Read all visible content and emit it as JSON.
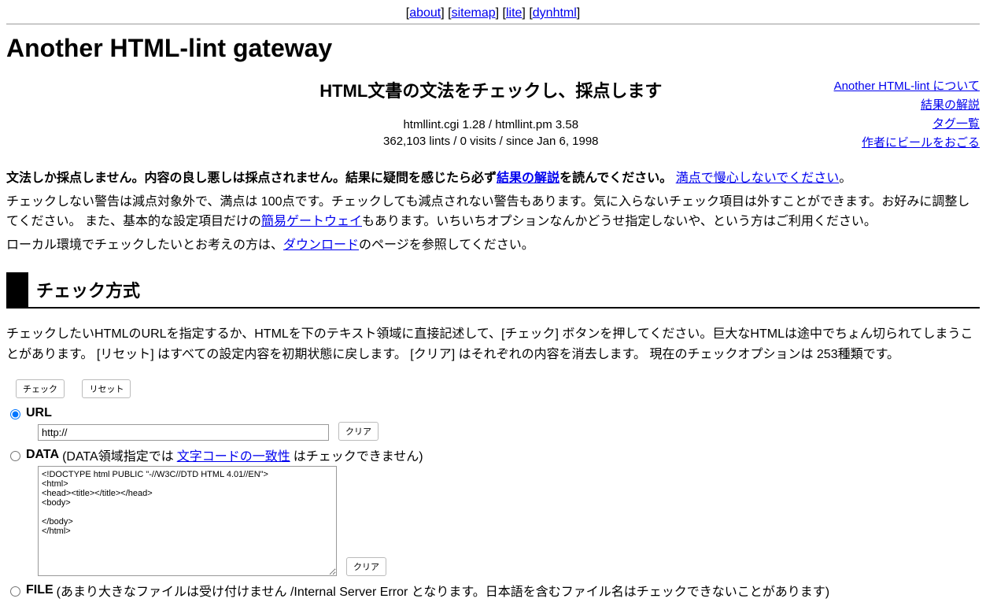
{
  "nav": {
    "about": "about",
    "sitemap": "sitemap",
    "lite": "lite",
    "dynhtml": "dynhtml"
  },
  "title": "Another HTML-lint gateway",
  "tagline": "HTML文書の文法をチェックし、採点します",
  "meta_version": "htmllint.cgi 1.28 / htmllint.pm 3.58",
  "meta_stats": "362,103 lints / 0 visits / since Jan 6, 1998",
  "sidelinks": {
    "about": "Another HTML-lint について",
    "result_explain": "結果の解説",
    "tag_list": "タグ一覧",
    "beer": "作者にビールをおごる"
  },
  "intro": {
    "p1a": "文法しか採点しません。内容の良し悪しは採点されません。結果に疑問を感じたら必ず",
    "p1_link1": "結果の解説",
    "p1b": "を読んでください。",
    "p1_link2": "満点で慢心しないでください",
    "p1c": "。",
    "p2a": "チェックしない警告は減点対象外で、満点は 100点です。チェックしても減点されない警告もあります。気に入らないチェック項目は外すことができます。お好みに調整してください。 また、基本的な設定項目だけの",
    "p2_link": "簡易ゲートウェイ",
    "p2b": "もあります。いちいちオプションなんかどうせ指定しないや、という方はご利用ください。",
    "p3a": "ローカル環境でチェックしたいとお考えの方は、",
    "p3_link": "ダウンロード",
    "p3b": "のページを参照してください。"
  },
  "section1_title": "チェック方式",
  "section1_desc": "チェックしたいHTMLのURLを指定するか、HTMLを下のテキスト領域に直接記述して、[チェック] ボタンを押してください。巨大なHTMLは途中でちょん切られてしまうことがあります。 [リセット] はすべての設定内容を初期状態に戻します。 [クリア] はそれぞれの内容を消去します。 現在のチェックオプションは 253種類です。",
  "buttons": {
    "check": "チェック",
    "reset": "リセット",
    "clear": "クリア"
  },
  "options": {
    "url_label": "URL",
    "url_value": "http://",
    "data_label": "DATA",
    "data_note_a": " (DATA領域指定では",
    "data_note_link": "文字コードの一致性",
    "data_note_b": "はチェックできません)",
    "data_value": "<!DOCTYPE html PUBLIC \"-//W3C//DTD HTML 4.01//EN\">\n<html>\n<head><title></title></head>\n<body>\n\n</body>\n</html>",
    "file_label": "FILE",
    "file_note": " (あまり大きなファイルは受け付けません /Internal Server Error となります。日本語を含むファイル名はチェックできないことがあります)"
  }
}
